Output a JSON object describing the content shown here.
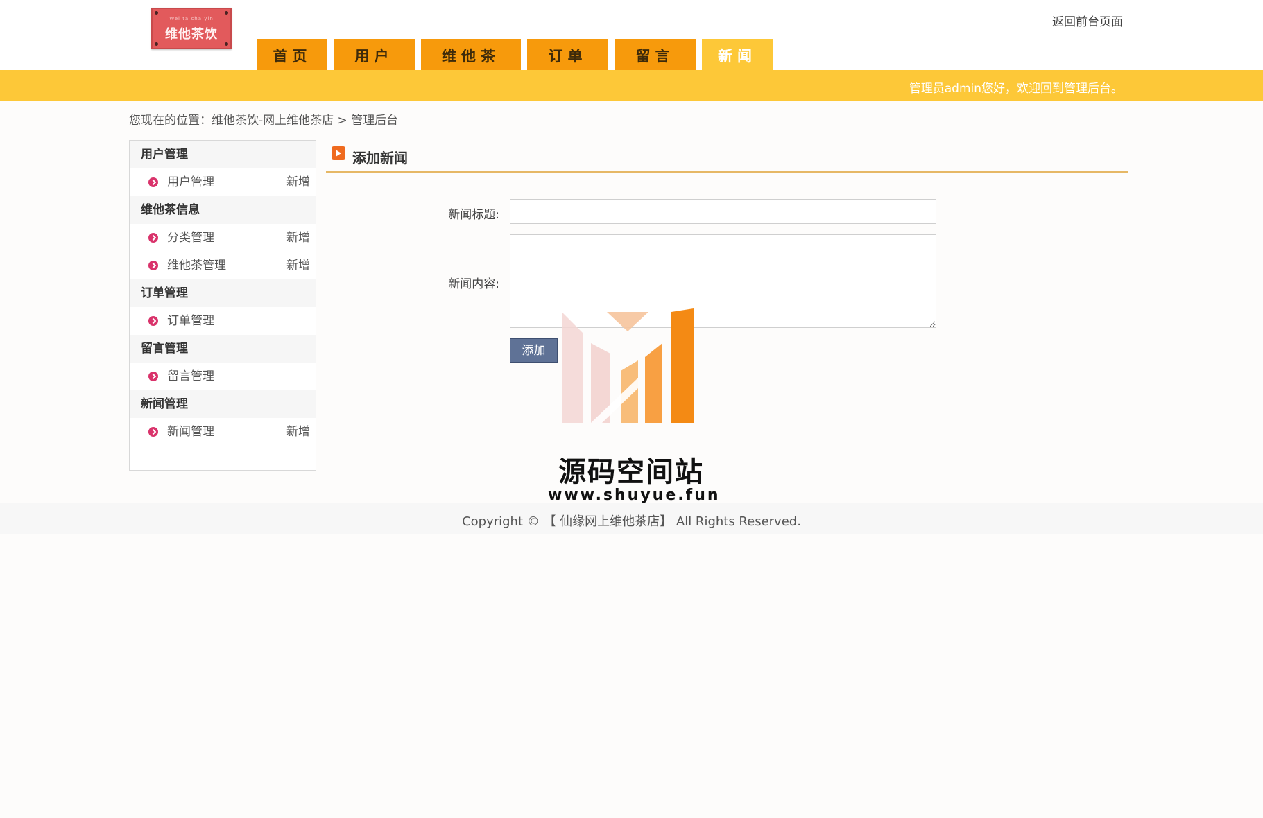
{
  "header": {
    "logo_text": "维他茶饮",
    "logo_subtext": "Wei ta cha yin",
    "back_link": "返回前台页面",
    "welcome": "管理员admin您好，欢迎回到管理后台。"
  },
  "nav": {
    "tabs": [
      {
        "label": "首页",
        "active": false
      },
      {
        "label": "用户",
        "active": false
      },
      {
        "label": "维他茶",
        "active": false
      },
      {
        "label": "订单",
        "active": false
      },
      {
        "label": "留言",
        "active": false
      },
      {
        "label": "新闻",
        "active": true
      }
    ]
  },
  "breadcrumb": "您现在的位置：维他茶饮-网上维他茶店 > 管理后台",
  "sidebar": {
    "sections": [
      {
        "title": "用户管理",
        "items": [
          {
            "label": "用户管理",
            "add": "新增"
          }
        ]
      },
      {
        "title": "维他茶信息",
        "items": [
          {
            "label": "分类管理",
            "add": "新增"
          },
          {
            "label": "维他茶管理",
            "add": "新增"
          }
        ]
      },
      {
        "title": "订单管理",
        "items": [
          {
            "label": "订单管理",
            "add": ""
          }
        ]
      },
      {
        "title": "留言管理",
        "items": [
          {
            "label": "留言管理",
            "add": ""
          }
        ]
      },
      {
        "title": "新闻管理",
        "items": [
          {
            "label": "新闻管理",
            "add": "新增"
          }
        ]
      }
    ]
  },
  "main": {
    "panel_title": "添加新闻",
    "form": {
      "title_label": "新闻标题:",
      "title_value": "",
      "content_label": "新闻内容:",
      "content_value": "",
      "submit_label": "添加"
    }
  },
  "watermark": {
    "title": "源码空间站",
    "url": "www.shuyue.fun"
  },
  "footer": {
    "copyright": "Copyright © 【 仙缘网上维他茶店】 All Rights Reserved."
  },
  "colors": {
    "nav_tab": "#f79a0c",
    "nav_active": "#fdc838",
    "bar": "#fdc838",
    "button": "#5f7296",
    "bullet": "#d9336b"
  }
}
